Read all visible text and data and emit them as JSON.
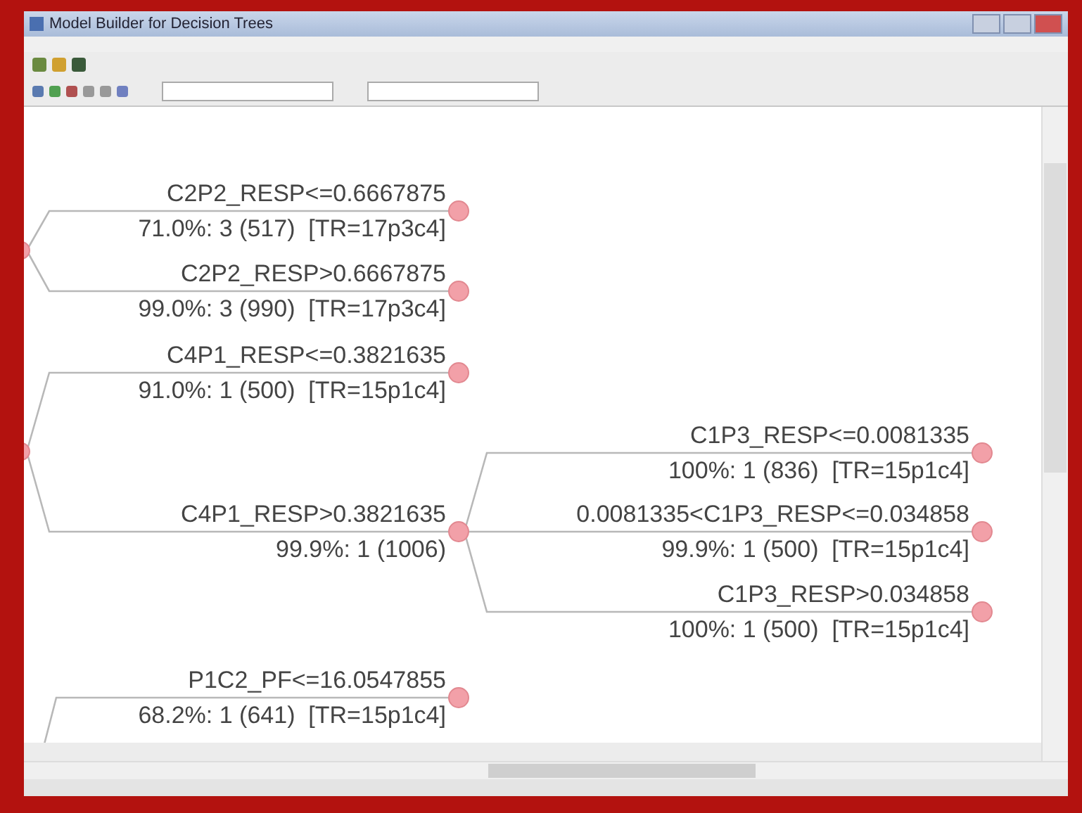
{
  "window": {
    "title": "Model Builder for Decision Trees"
  },
  "tree": [
    {
      "children": [
        {
          "condition": "C2P2_RESP<=0.6667875",
          "stats": "71.0%: 3 (517)  [TR=17p3c4]"
        },
        {
          "condition": "C2P2_RESP>0.6667875",
          "stats": "99.0%: 3 (990)  [TR=17p3c4]"
        }
      ]
    },
    {
      "children": [
        {
          "condition": "C4P1_RESP<=0.3821635",
          "stats": "91.0%: 1 (500)  [TR=15p1c4]"
        },
        {
          "condition": "C4P1_RESP>0.3821635",
          "stats": "99.9%: 1 (1006)",
          "children": [
            {
              "condition": "C1P3_RESP<=0.0081335",
              "stats": "100%: 1 (836)  [TR=15p1c4]"
            },
            {
              "condition": "0.0081335<C1P3_RESP<=0.034858",
              "stats": "99.9%: 1 (500)  [TR=15p1c4]"
            },
            {
              "condition": "C1P3_RESP>0.034858",
              "stats": "100%: 1 (500)  [TR=15p1c4]"
            }
          ]
        }
      ]
    },
    {
      "children": [
        {
          "condition": "P1C2_PF<=16.0547855",
          "stats": "68.2%: 1 (641)  [TR=15p1c4]"
        }
      ]
    }
  ]
}
